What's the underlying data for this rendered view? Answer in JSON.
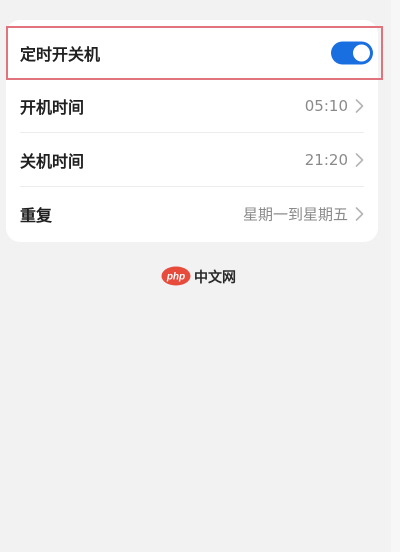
{
  "settings": {
    "timer": {
      "label": "定时开关机",
      "enabled": true
    },
    "power_on": {
      "label": "开机时间",
      "value": "05:10"
    },
    "power_off": {
      "label": "关机时间",
      "value": "21:20"
    },
    "repeat": {
      "label": "重复",
      "value": "星期一到星期五"
    }
  },
  "watermark": {
    "logo_text": "php",
    "site_text": "中文网"
  },
  "colors": {
    "accent": "#1a6fe0",
    "highlight": "#e0737c",
    "watermark": "#e64b3c"
  }
}
